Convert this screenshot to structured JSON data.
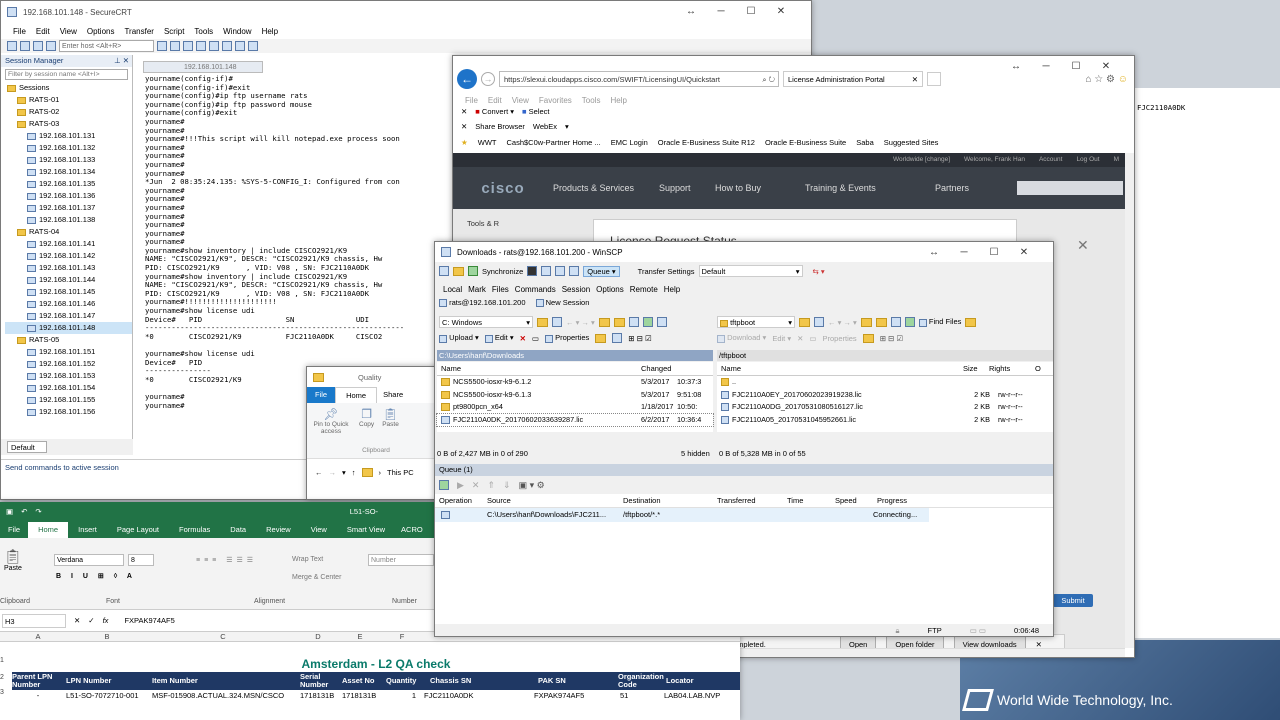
{
  "desktop": {
    "wwt_logo": "World Wide Technology, Inc."
  },
  "securecrt": {
    "title": "192.168.101.148 - SecureCRT",
    "menu": [
      "File",
      "Edit",
      "View",
      "Options",
      "Transfer",
      "Script",
      "Tools",
      "Window",
      "Help"
    ],
    "enter_host_placeholder": "Enter host <Alt+R>",
    "session_manager": "Session Manager",
    "filter_placeholder": "Filter by session name <Alt+I>",
    "tree": [
      "Sessions",
      "RATS-01",
      "RATS-02",
      "RATS-03",
      "192.168.101.131",
      "192.168.101.132",
      "192.168.101.133",
      "192.168.101.134",
      "192.168.101.135",
      "192.168.101.136",
      "192.168.101.137",
      "192.168.101.138",
      "RATS-04",
      "192.168.101.141",
      "192.168.101.142",
      "192.168.101.143",
      "192.168.101.144",
      "192.168.101.145",
      "192.168.101.146",
      "192.168.101.147",
      "192.168.101.148",
      "RATS-05",
      "192.168.101.151",
      "192.168.101.152",
      "192.168.101.153",
      "192.168.101.154",
      "192.168.101.155",
      "192.168.101.156"
    ],
    "selected_session": "192.168.101.148",
    "tab": "192.168.101.148",
    "default_label": "Default",
    "send_cmd": "Send commands to active session",
    "terminal": "yourname(config-if)#\nyourname(config-if)#exit\nyourname(config)#ip ftp username rats\nyourname(config)#ip ftp password mouse\nyourname(config)#exit\nyourname#\nyourname#\nyourname#!!!This script will kill notepad.exe process soon\nyourname#\nyourname#\nyourname#\nyourname#\n*Jun  2 08:35:24.135: %SYS-5-CONFIG_I: Configured from con\nyourname#\nyourname#\nyourname#\nyourname#\nyourname#\nyourname#\nyourname#\nyourname#show inventory | include CISCO2921/K9\nNAME: \"CISCO2921/K9\", DESCR: \"CISCO2921/K9 chassis, Hw\nPID: CISCO2921/K9      , VID: V08 , SN: FJC2110A0DK\nyourname#show inventory | include CISCO2921/K9\nNAME: \"CISCO2921/K9\", DESCR: \"CISCO2921/K9 chassis, Hw\nPID: CISCO2921/K9      , VID: V08 , SN: FJC2110A0DK\nyourname#!!!!!!!!!!!!!!!!!!!!!\nyourname#show license udi\nDevice#   PID                   SN              UDI\n-----------------------------------------------------------\n*0        CISCO2921/K9          FJC2110A0DK     CISCO2\n\nyourname#show license udi\nDevice#   PID\n---------------\n*0        CISCO2921/K9\n\nyourname#\nyourname#",
    "right_term": "FJC2110A0DK"
  },
  "browser": {
    "url": "https://slexui.cloudapps.cisco.com/SWIFT/LicensingUI/Quickstart",
    "tab": "License Administration Portal",
    "menu": [
      "File",
      "Edit",
      "View",
      "Favorites",
      "Tools",
      "Help"
    ],
    "convert": "Convert",
    "select": "Select",
    "share": "Share Browser",
    "webex": "WebEx",
    "favorites": [
      "WWT",
      "Cash$C0w-Partner Home ...",
      "EMC Login",
      "Oracle E-Business Suite R12",
      "Oracle E-Business Suite",
      "Saba",
      "Suggested Sites"
    ],
    "cisco_top": [
      "Worldwide [change]",
      "Welcome, Frank Han",
      "Account",
      "Log Out",
      "M"
    ],
    "cisco_logo": "cisco",
    "nav": [
      "Products & Services",
      "Support",
      "How to Buy",
      "Training & Events",
      "Partners"
    ],
    "tools_label": "Tools & R",
    "dialog_title": "License Request Status",
    "submit": "Submit",
    "download_msg": "The FJC2110A0DK_20170602033639287.lic download has completed.",
    "open": "Open",
    "open_folder": "Open folder",
    "view_downloads": "View downloads"
  },
  "explorer": {
    "title": "Quality",
    "tabs": [
      "File",
      "Home",
      "Share"
    ],
    "buttons": [
      "Pin to Quick access",
      "Copy",
      "Paste"
    ],
    "group": "Clipboard",
    "path": "This PC"
  },
  "winscp": {
    "title": "Downloads - rats@192.168.101.200 - WinSCP",
    "toolbar": [
      "Synchronize",
      "Queue",
      "Transfer Settings",
      "Default"
    ],
    "menu": [
      "Local",
      "Mark",
      "Files",
      "Commands",
      "Session",
      "Options",
      "Remote",
      "Help"
    ],
    "session_tab": "rats@192.168.101.200",
    "new_session": "New Session",
    "left_drive": "C: Windows",
    "right_dir": "tftpboot",
    "find_files": "Find Files",
    "left_actions": [
      "Upload",
      "Edit",
      "Properties"
    ],
    "right_actions": [
      "Download",
      "Edit",
      "Properties"
    ],
    "left_path": "C:\\Users\\hanf\\Downloads",
    "right_path": "/tftpboot",
    "left_cols": [
      "Name",
      "Changed"
    ],
    "right_cols": [
      "Name",
      "Size",
      "Rights",
      "O"
    ],
    "left_files": [
      [
        "NCS5500-iosxr-k9-6.1.2",
        "5/3/2017",
        "10:37:3"
      ],
      [
        "NCS5500-iosxr-k9-6.1.3",
        "5/3/2017",
        "9:51:08"
      ],
      [
        "pt9800pcn_x64",
        "1/18/2017",
        "10:50:"
      ],
      [
        "FJC2110A0DK_20170602033639287.lic",
        "6/2/2017",
        "10:36:4"
      ]
    ],
    "right_files": [
      [
        "..",
        "",
        ""
      ],
      [
        "FJC2110A0EY_20170602023919238.lic",
        "2 KB",
        "rw-r--r--"
      ],
      [
        "FJC2110A0DG_20170531080516127.lic",
        "2 KB",
        "rw-r--r--"
      ],
      [
        "FJC2110A05_20170531045952661.lic",
        "2 KB",
        "rw-r--r--"
      ]
    ],
    "left_status": "0 B of 2,427 MB in 0 of 290",
    "hidden": "5 hidden",
    "right_status": "0 B of 5,328 MB in 0 of 55",
    "queue_label": "Queue (1)",
    "queue_cols": [
      "Operation",
      "Source",
      "Destination",
      "Transferred",
      "Time",
      "Speed",
      "Progress"
    ],
    "queue_row": {
      "source": "C:\\Users\\hanf\\Downloads\\FJC211...",
      "dest": "/tftpboot/*.*",
      "progress": "Connecting..."
    },
    "status_ftp": "FTP",
    "status_time": "0:06:48"
  },
  "excel": {
    "title": "L51-SO-",
    "tabs": [
      "File",
      "Home",
      "Insert",
      "Page Layout",
      "Formulas",
      "Data",
      "Review",
      "View",
      "Smart View",
      "ACRO"
    ],
    "font": "Verdana",
    "size": "8",
    "wrap": "Wrap Text",
    "merge": "Merge & Center",
    "number": "Number",
    "groups": [
      "Clipboard",
      "Font",
      "Alignment",
      "Number"
    ],
    "paste": "Paste",
    "cell_ref": "H3",
    "formula": "FXPAK974AF5",
    "cols": [
      "A",
      "B",
      "C",
      "D",
      "E",
      "F"
    ],
    "heading": "Amsterdam - L2 QA check",
    "headers": [
      "Parent LPN Number",
      "LPN Number",
      "Item Number",
      "Serial Number",
      "Asset No",
      "Quantity",
      "Chassis SN",
      "PAK SN",
      "Organization Code",
      "Locator"
    ],
    "row": [
      "-",
      "L51-SO-7072710-001",
      "MSF-015908.ACTUAL.324.MSN/CSCO",
      "1718131B",
      "1718131B",
      "1",
      "FJC2110A0DK",
      "FXPAK974AF5",
      "51",
      "LAB04.LAB.NVP"
    ],
    "row_nums": [
      "1",
      "2",
      "3"
    ]
  }
}
